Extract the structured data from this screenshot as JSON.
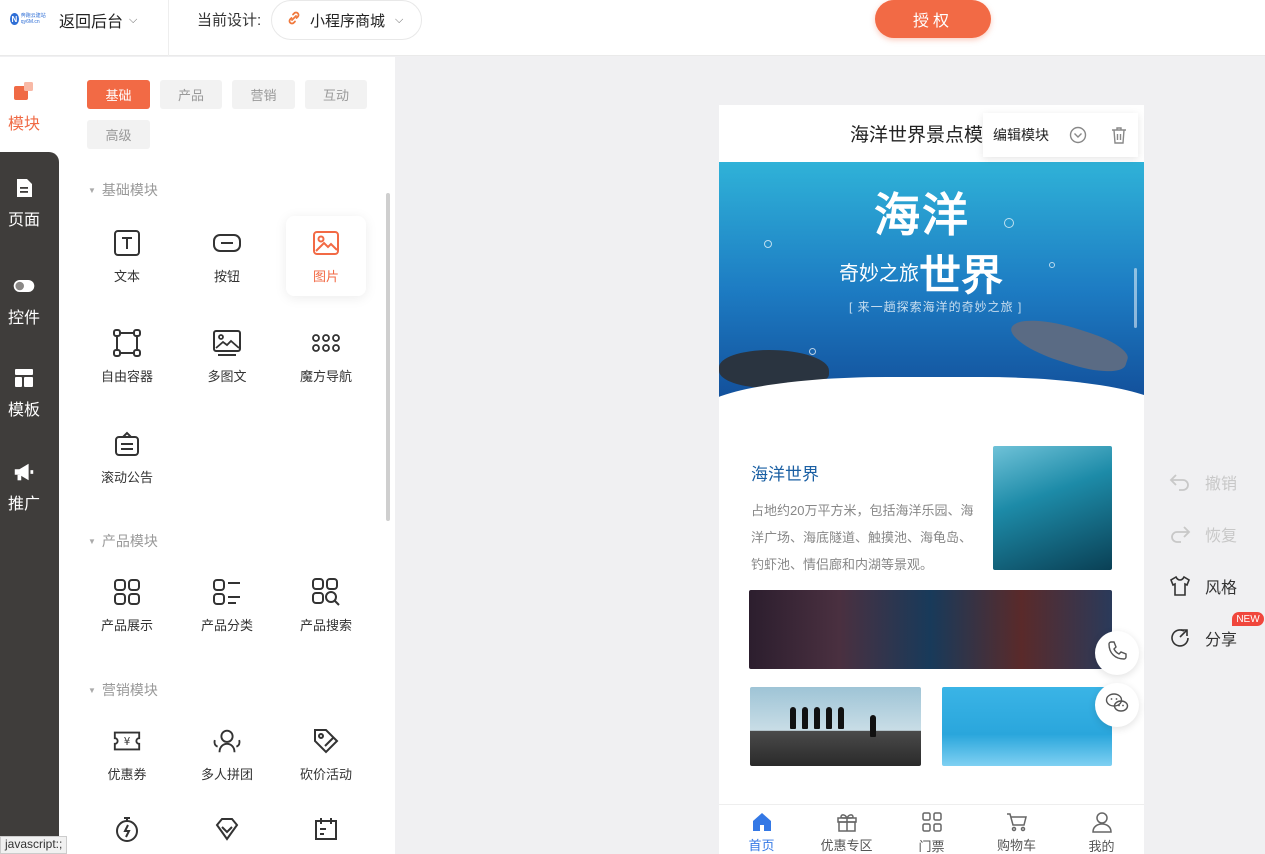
{
  "topbar": {
    "logo_text": "奔跑云建站 qy6M.cn",
    "back_label": "返回后台",
    "current_design_label": "当前设计:",
    "design_name": "小程序商城",
    "auth_label": "授权"
  },
  "rail": {
    "items": [
      {
        "label": "模块",
        "icon": "module-icon"
      },
      {
        "label": "页面",
        "icon": "page-icon"
      },
      {
        "label": "控件",
        "icon": "toggle-icon"
      },
      {
        "label": "模板",
        "icon": "template-icon"
      },
      {
        "label": "推广",
        "icon": "megaphone-icon"
      }
    ]
  },
  "panel": {
    "tabs": [
      "基础",
      "产品",
      "营销",
      "互动",
      "高级"
    ],
    "sections": [
      {
        "title": "基础模块",
        "items": [
          "文本",
          "按钮",
          "图片",
          "自由容器",
          "多图文",
          "魔方导航",
          "滚动公告"
        ]
      },
      {
        "title": "产品模块",
        "items": [
          "产品展示",
          "产品分类",
          "产品搜索"
        ]
      },
      {
        "title": "营销模块",
        "items": [
          "优惠券",
          "多人拼团",
          "砍价活动"
        ]
      }
    ]
  },
  "status_text": "javascript:;",
  "phone": {
    "title": "海洋世界景点模",
    "edit_popup_label": "编辑模块",
    "banner": {
      "title": "海洋",
      "subtitle": "奇妙之旅",
      "title2": "世界",
      "tagline": "[ 来一趟探索海洋的奇妙之旅 ]"
    },
    "card_title": "海洋世界",
    "card_desc": "占地约20万平方米，包括海洋乐园、海洋广场、海底隧道、触摸池、海龟岛、钓虾池、情侣廊和内湖等景观。",
    "tabbar": [
      "首页",
      "优惠专区",
      "门票",
      "购物车",
      "我的"
    ]
  },
  "actions": {
    "undo": "撤销",
    "redo": "恢复",
    "style": "风格",
    "share": "分享",
    "new_badge": "NEW"
  },
  "colors": {
    "accent": "#f26a45",
    "tab_active": "#3478e5",
    "title_blue": "#1a5fa3"
  }
}
